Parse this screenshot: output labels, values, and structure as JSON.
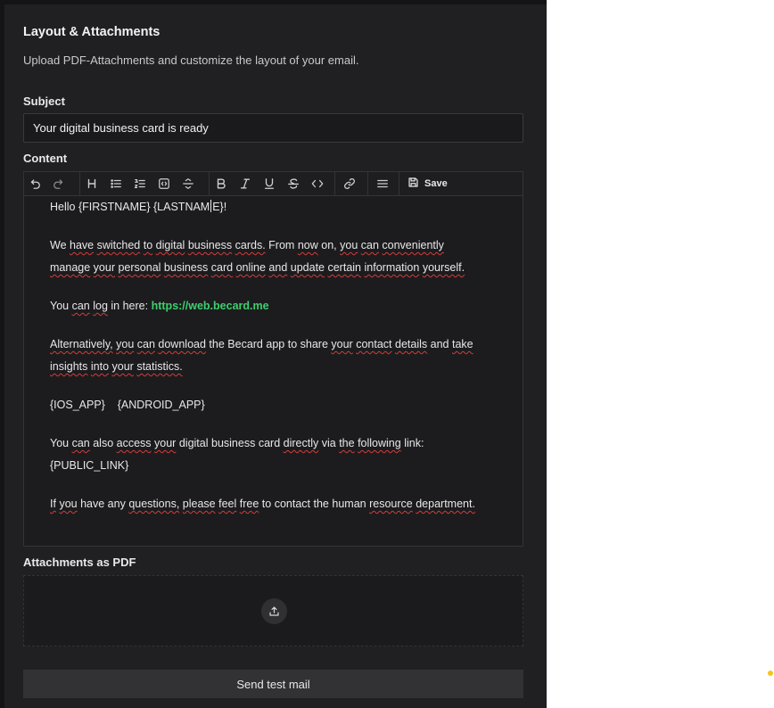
{
  "header": {
    "title": "Layout & Attachments",
    "subtitle": "Upload PDF-Attachments and customize the layout of your email."
  },
  "subject": {
    "label": "Subject",
    "value": "Your digital business card is ready"
  },
  "content": {
    "label": "Content",
    "toolbar": {
      "icons": [
        "undo-icon",
        "redo-icon",
        "heading-icon",
        "bullet-list-icon",
        "ordered-list-icon",
        "code-block-icon",
        "horizontal-rule-icon",
        "bold-icon",
        "italic-icon",
        "underline-icon",
        "strikethrough-icon",
        "inline-code-icon",
        "link-icon",
        "align-icon",
        "save-icon"
      ],
      "save_label": "Save"
    },
    "body": {
      "greeting_a": "Hello {FIRSTNAME} {LASTNAM",
      "greeting_b": "E}!",
      "p1_w1": "We",
      "p1_w2": "have",
      "p1_w3": "switched",
      "p1_w4": "to",
      "p1_w5": "digital",
      "p1_w6": "business",
      "p1_w7": "cards.",
      "p1_w8": "From",
      "p1_w9": "now",
      "p1_w10": "on,",
      "p1_w11": "you",
      "p1_w12": "can",
      "p1_w13": "conveniently",
      "p1_w14": "manage",
      "p1_w15": "your",
      "p1_w16": "personal",
      "p1_w17": "business",
      "p1_w18": "card",
      "p1_w19": "online",
      "p1_w20": "and",
      "p1_w21": "update",
      "p1_w22": "certain",
      "p1_w23": "information",
      "p1_w24": "yourself.",
      "p2_w1": "You",
      "p2_w2": "can",
      "p2_w3": "log",
      "p2_w4": "in",
      "p2_w5": "here:",
      "p2_link": "https://web.becard.me",
      "p3_w1": "Alternatively,",
      "p3_w2": "you",
      "p3_w3": "can",
      "p3_w4": "download",
      "p3_w5": "the",
      "p3_w6": "Becard",
      "p3_w7": "app",
      "p3_w8": "to",
      "p3_w9": "share",
      "p3_w10": "your",
      "p3_w11": "contact",
      "p3_w12": "details",
      "p3_w13": "and",
      "p3_w14": "take",
      "p3_w15": "insights",
      "p3_w16": "into",
      "p3_w17": "your",
      "p3_w18": "statistics.",
      "p4": "{IOS_APP}    {ANDROID_APP}",
      "p5_w1": "You",
      "p5_w2": "can",
      "p5_w3": "also",
      "p5_w4": "access",
      "p5_w5": "your",
      "p5_w6": "digital",
      "p5_w7": "business",
      "p5_w8": "card",
      "p5_w9": "directly",
      "p5_w10": "via",
      "p5_w11": "the",
      "p5_w12": "following",
      "p5_w13": "link:",
      "p5_line2": "{PUBLIC_LINK}",
      "p6_w1": "If",
      "p6_w2": "you",
      "p6_w3": "have",
      "p6_w4": "any",
      "p6_w5": "questions,",
      "p6_w6": "please",
      "p6_w7": "feel",
      "p6_w8": "free",
      "p6_w9": "to",
      "p6_w10": "contact",
      "p6_w11": "the",
      "p6_w12": "human",
      "p6_w13": "resource",
      "p6_w14": "department."
    }
  },
  "attachments": {
    "label": "Attachments as PDF",
    "upload_icon": "upload-icon"
  },
  "actions": {
    "send_test_label": "Send test mail"
  },
  "colors": {
    "background": "#202022",
    "link": "#3ccf6e",
    "spellcheck": "#d23c3c",
    "accent_dot": "#f5c518"
  }
}
